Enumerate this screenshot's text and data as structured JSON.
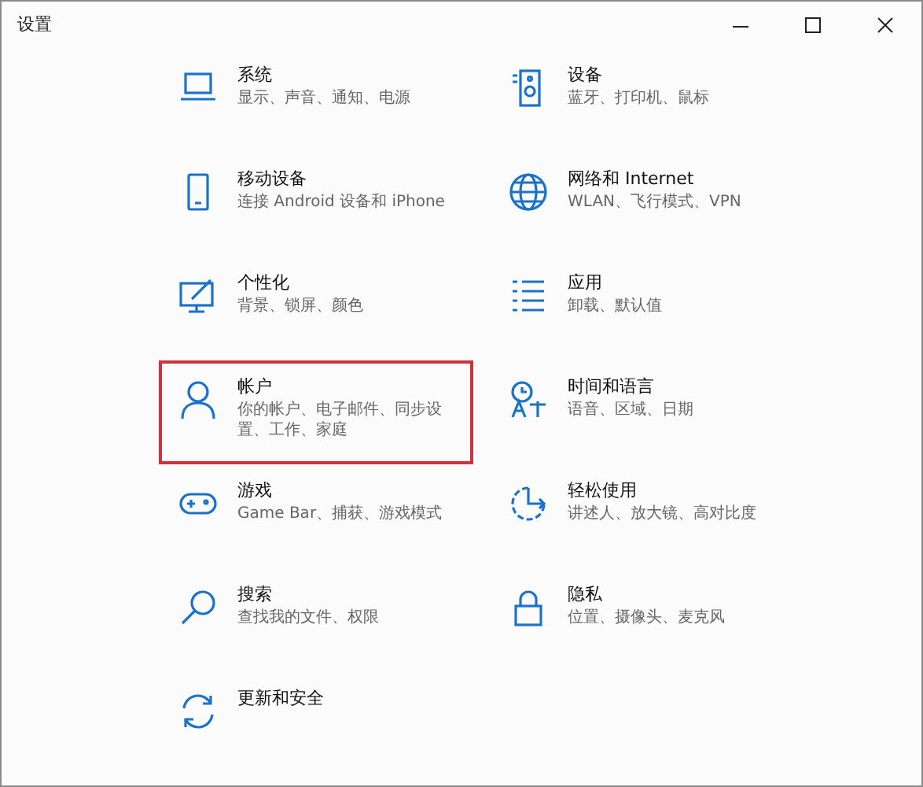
{
  "window": {
    "title": "设置"
  },
  "items": [
    {
      "title": "系统",
      "description": "显示、声音、通知、电源",
      "selected": false
    },
    {
      "title": "设备",
      "description": "蓝牙、打印机、鼠标",
      "selected": false
    },
    {
      "title": "移动设备",
      "description": "连接 Android 设备和 iPhone",
      "selected": false
    },
    {
      "title": "网络和 Internet",
      "description": "WLAN、飞行模式、VPN",
      "selected": false
    },
    {
      "title": "个性化",
      "description": "背景、锁屏、颜色",
      "selected": false
    },
    {
      "title": "应用",
      "description": "卸载、默认值",
      "selected": false
    },
    {
      "title": "帐户",
      "description": "你的帐户、电子邮件、同步设置、工作、家庭",
      "selected": true
    },
    {
      "title": "时间和语言",
      "description": "语音、区域、日期",
      "selected": false
    },
    {
      "title": "游戏",
      "description": "Game Bar、捕获、游戏模式",
      "selected": false
    },
    {
      "title": "轻松使用",
      "description": "讲述人、放大镜、高对比度",
      "selected": false
    },
    {
      "title": "搜索",
      "description": "查找我的文件、权限",
      "selected": false
    },
    {
      "title": "隐私",
      "description": "位置、摄像头、麦克风",
      "selected": false
    },
    {
      "title": "更新和安全",
      "selected": false
    }
  ]
}
